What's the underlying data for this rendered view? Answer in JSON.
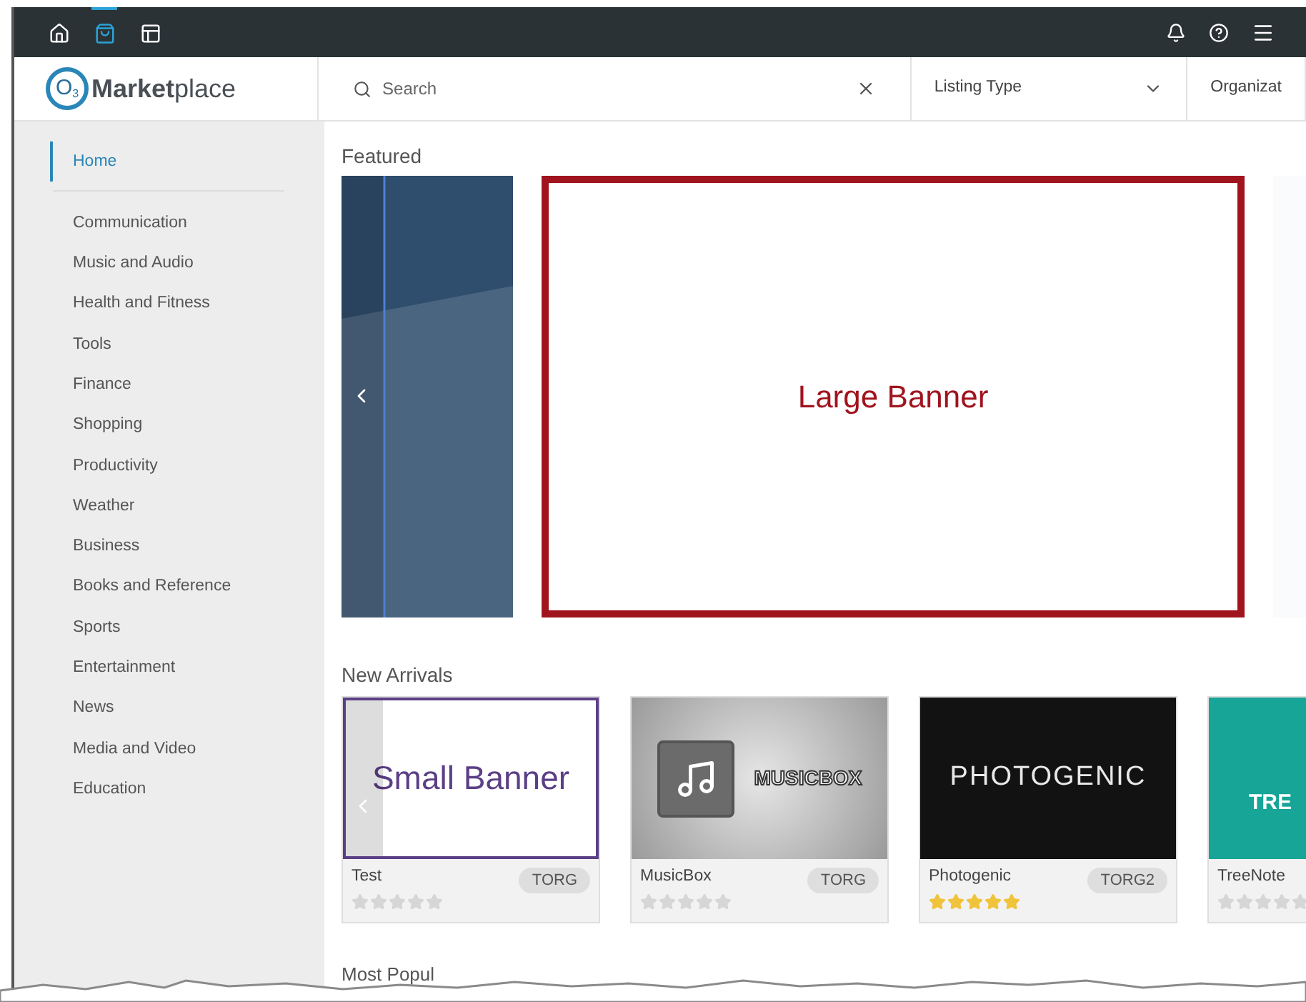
{
  "top_bar": {
    "tabs": [
      {
        "kind": "home",
        "selected": false
      },
      {
        "kind": "bag",
        "selected": true
      },
      {
        "kind": "layout",
        "selected": false
      }
    ]
  },
  "header": {
    "logo": {
      "mark": "O",
      "subscript": "3",
      "bold": "Market",
      "light": "place"
    },
    "search": {
      "placeholder": "Search"
    },
    "filters": [
      "Listing Type",
      "Organizat"
    ]
  },
  "sidebar": {
    "items": [
      {
        "label": "Home",
        "selected": true
      },
      {
        "label": "Communication",
        "selected": false
      },
      {
        "label": "Music and Audio",
        "selected": false
      },
      {
        "label": "Health and Fitness",
        "selected": false
      },
      {
        "label": "Tools",
        "selected": false
      },
      {
        "label": "Finance",
        "selected": false
      },
      {
        "label": "Shopping",
        "selected": false
      },
      {
        "label": "Productivity",
        "selected": false
      },
      {
        "label": "Weather",
        "selected": false
      },
      {
        "label": "Business",
        "selected": false
      },
      {
        "label": "Books and Reference",
        "selected": false
      },
      {
        "label": "Sports",
        "selected": false
      },
      {
        "label": "Entertainment",
        "selected": false
      },
      {
        "label": "News",
        "selected": false
      },
      {
        "label": "Media and Video",
        "selected": false
      },
      {
        "label": "Education",
        "selected": false
      }
    ]
  },
  "featured": {
    "title": "Featured",
    "banner": "Large Banner"
  },
  "new_arrivals": {
    "title": "New Arrivals",
    "cards": [
      {
        "kind": "small-banner",
        "banner": "Small Banner",
        "name": "Test",
        "org": "TORG",
        "stars": 0
      },
      {
        "kind": "musicbox",
        "banner": "MUSICBOX",
        "name": "MusicBox",
        "org": "TORG",
        "stars": 0
      },
      {
        "kind": "photogenic",
        "banner": "PHOTOGENIC",
        "name": "Photogenic",
        "org": "TORG2",
        "stars": 5
      },
      {
        "kind": "treenote",
        "banner": "TRE",
        "name": "TreeNote",
        "stars": 0
      }
    ]
  },
  "most_popular": {
    "title": "Most Popul"
  }
}
